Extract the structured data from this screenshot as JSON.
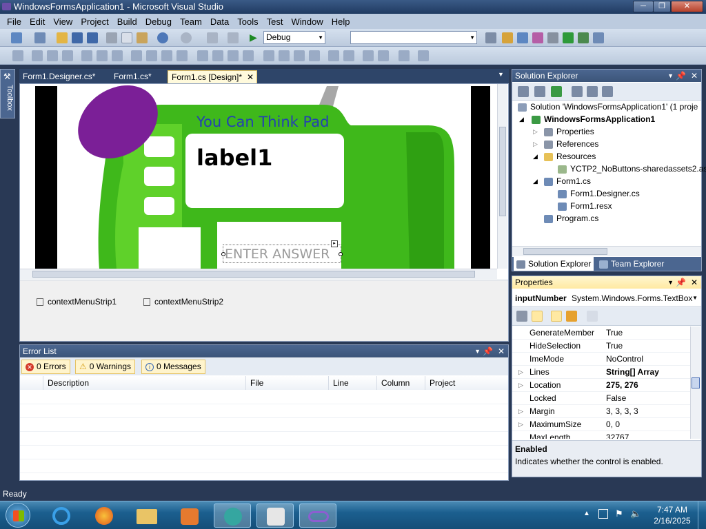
{
  "window": {
    "title": "WindowsFormsApplication1 - Microsoft Visual Studio",
    "min": "─",
    "max": "❐",
    "close": "✕"
  },
  "menu": [
    "File",
    "Edit",
    "View",
    "Project",
    "Build",
    "Debug",
    "Team",
    "Data",
    "Tools",
    "Test",
    "Window",
    "Help"
  ],
  "toolbar": {
    "config_value": "Debug",
    "platform_value": ""
  },
  "sidebar": {
    "toolbox_label": "Toolbox"
  },
  "doc_tabs": [
    {
      "label": "Form1.Designer.cs*"
    },
    {
      "label": "Form1.cs*"
    },
    {
      "label": "Form1.cs [Design]*",
      "close": "✕"
    }
  ],
  "form": {
    "heading": "You Can Think Pad",
    "label1": "label1",
    "input_placeholder": "ENTER ANSWER"
  },
  "tray": [
    "contextMenuStrip1",
    "contextMenuStrip2"
  ],
  "solution_explorer": {
    "title": "Solution Explorer",
    "items": [
      {
        "label": "Solution 'WindowsFormsApplication1' (1 proje"
      },
      {
        "label": "WindowsFormsApplication1"
      },
      {
        "label": "Properties"
      },
      {
        "label": "References"
      },
      {
        "label": "Resources"
      },
      {
        "label": "YCTP2_NoButtons-sharedassets2.as"
      },
      {
        "label": "Form1.cs"
      },
      {
        "label": "Form1.Designer.cs"
      },
      {
        "label": "Form1.resx"
      },
      {
        "label": "Program.cs"
      }
    ],
    "tabs": [
      "Solution Explorer",
      "Team Explorer"
    ]
  },
  "properties": {
    "title": "Properties",
    "object_name": "inputNumber",
    "object_type": "System.Windows.Forms.TextBox",
    "rows": [
      {
        "name": "GenerateMember",
        "value": "True"
      },
      {
        "name": "HideSelection",
        "value": "True"
      },
      {
        "name": "ImeMode",
        "value": "NoControl"
      },
      {
        "name": "Lines",
        "value": "String[] Array"
      },
      {
        "name": "Location",
        "value": "275, 276"
      },
      {
        "name": "Locked",
        "value": "False"
      },
      {
        "name": "Margin",
        "value": "3, 3, 3, 3"
      },
      {
        "name": "MaximumSize",
        "value": "0, 0"
      },
      {
        "name": "MaxLength",
        "value": "32767"
      }
    ],
    "desc_title": "Enabled",
    "desc_text": "Indicates whether the control is enabled."
  },
  "error_list": {
    "title": "Error List",
    "errors": "0 Errors",
    "warnings": "0 Warnings",
    "messages": "0 Messages",
    "columns": [
      "Description",
      "File",
      "Line",
      "Column",
      "Project"
    ]
  },
  "status": {
    "text": "Ready"
  },
  "taskbar": {
    "time": "7:47 AM",
    "date": "2/16/2025"
  }
}
